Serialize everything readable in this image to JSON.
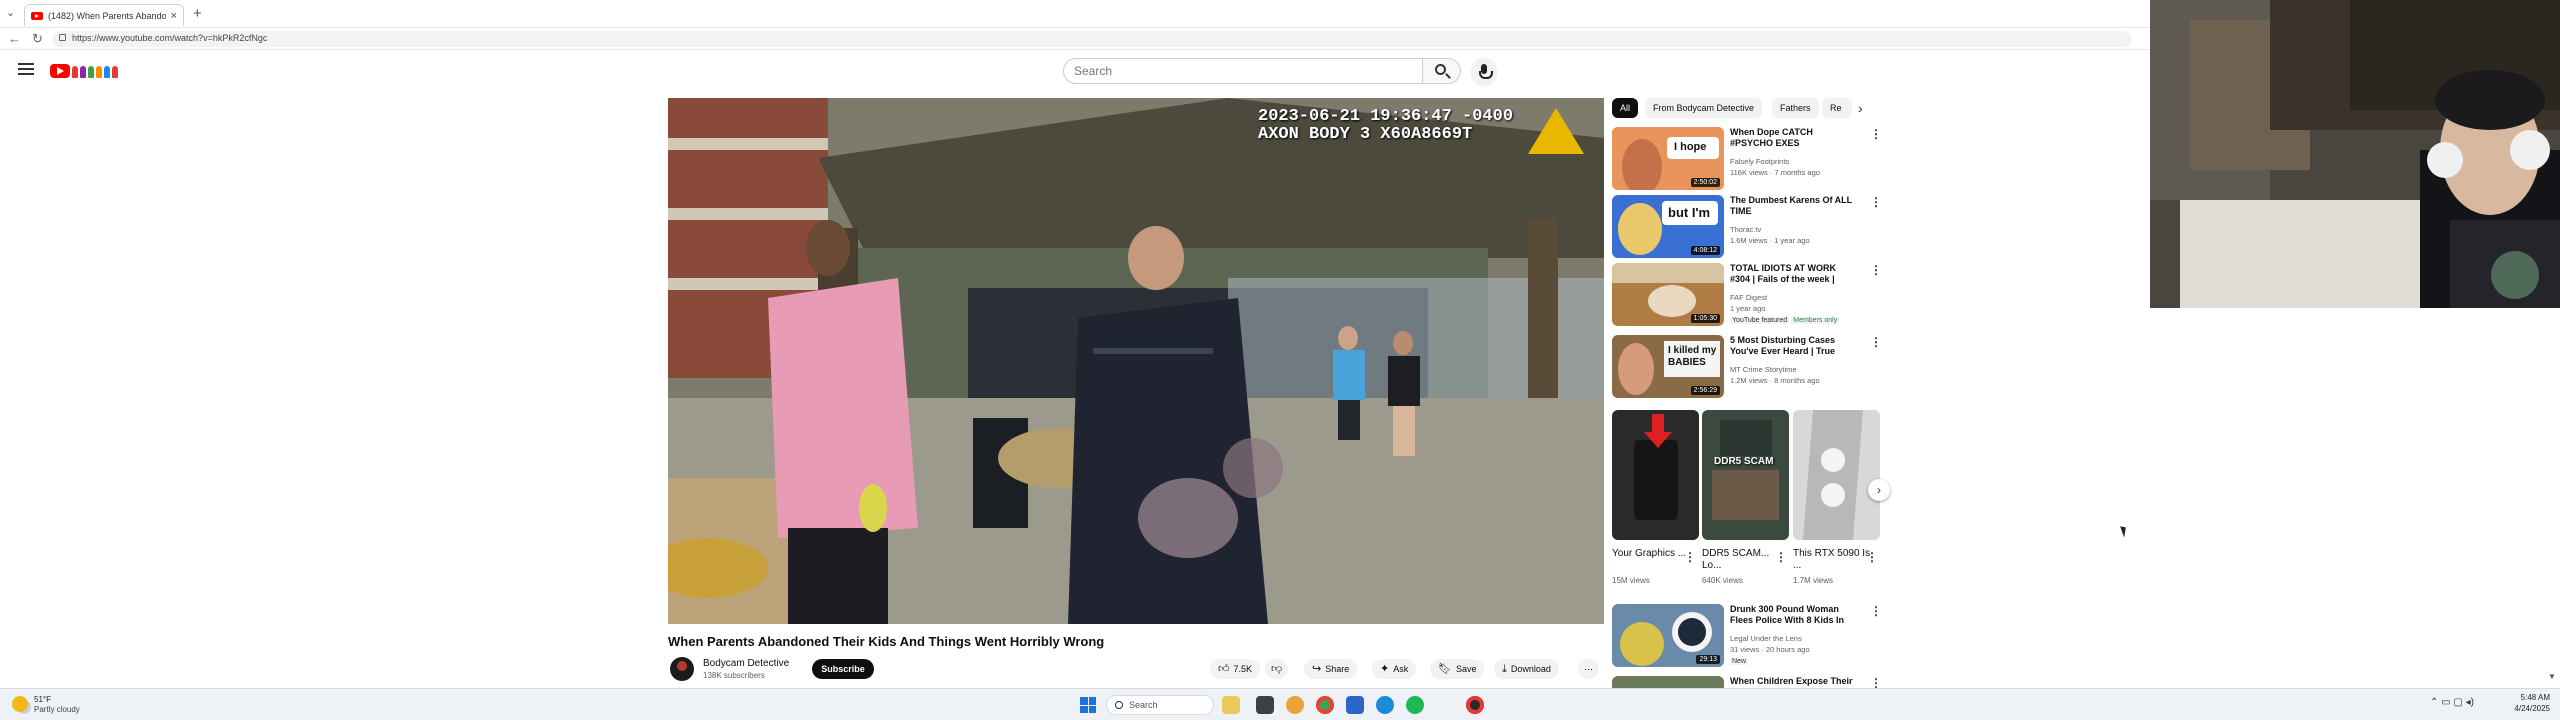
{
  "browser": {
    "tab_title": "(1482) When Parents Abando",
    "new_tab": "+",
    "close": "×",
    "url": "https://www.youtube.com/watch?v=hkPkR2cfNgc"
  },
  "youtube": {
    "search_placeholder": "Search"
  },
  "video": {
    "overlay_timestamp": "2023-06-21 19:36:47 -0400\nAXON BODY 3 X60A8669T",
    "title": "When Parents Abandoned Their Kids And Things Went Horribly Wrong",
    "channel": "Bodycam Detective",
    "subscribers": "138K subscribers",
    "subscribe_label": "Subscribe",
    "actions": {
      "likes": "7.5K",
      "share": "Share",
      "ask": "Ask",
      "save": "Save",
      "download": "Download",
      "more": "⋯"
    }
  },
  "sidebar": {
    "chips": [
      "All",
      "From Bodycam Detective",
      "Fathers",
      "Re"
    ],
    "recommendations": [
      {
        "title": "When Dope CATCH #PSYCHO EXES",
        "channel": "Falsely Footprints",
        "meta": "116K views · 7 months ago",
        "duration": "2:50:02",
        "thumb_text": "I hope",
        "thumb_color": "#d97a3a"
      },
      {
        "title": "The Dumbest Karens Of ALL TIME",
        "channel": "Thorac.tv",
        "meta": "1.6M views · 1 year ago",
        "duration": "4:08:12",
        "thumb_text": "but I'm",
        "thumb_color": "#2d5fbf"
      },
      {
        "title": "TOTAL IDIOTS AT WORK #304 | Fails of the week | Instant regr...",
        "channel": "FAF Digest",
        "meta": "1 year ago",
        "badge1": "YouTube featured",
        "badge2": "Members only",
        "duration": "1:05:30",
        "thumb_text": "",
        "thumb_color": "#a8713e"
      },
      {
        "title": "5 Most Disturbing Cases You've Ever Heard | True Crime ...",
        "channel": "MT Crime Storytime",
        "meta": "1.2M views · 8 months ago",
        "duration": "2:56:29",
        "thumb_text": "I killed my BABIES",
        "thumb_color": "#7a5a3a"
      }
    ],
    "shorts": [
      {
        "title": "Your Graphics ...",
        "views": "15M views",
        "color": "#2a2a2a"
      },
      {
        "title": "DDR5 SCAM... Lo...",
        "views": "640K views",
        "color": "#3a4a3e",
        "thumb_text": "DDR5 SCAM"
      },
      {
        "title": "This RTX 5090 Is ...",
        "views": "1.7M views",
        "color": "#c4c4c4"
      }
    ],
    "bottom_recs": [
      {
        "title": "Drunk 300 Pound Woman Flees Police With 8 Kids In Tesla and...",
        "channel": "Legal Under the Lens",
        "meta": "31 views · 20 hours ago",
        "badge": "New",
        "duration": "29:13",
        "thumb_color": "#4a6a8a"
      },
      {
        "title": "When Children Expose Their",
        "channel": "",
        "meta": "",
        "duration": "",
        "thumb_color": "#6a7a5a"
      }
    ],
    "more_icon": "⋮",
    "next_arrow": "›"
  },
  "taskbar": {
    "weather_temp": "51°F",
    "weather_desc": "Partly cloudy",
    "search_label": "Search",
    "tray": "⌃  ▭  ▢  ◂)",
    "time": "5:48 AM",
    "date": "4/24/2025"
  },
  "colors": {
    "youtube_red": "#ff0000",
    "windows_blue": "#1e74d6"
  }
}
